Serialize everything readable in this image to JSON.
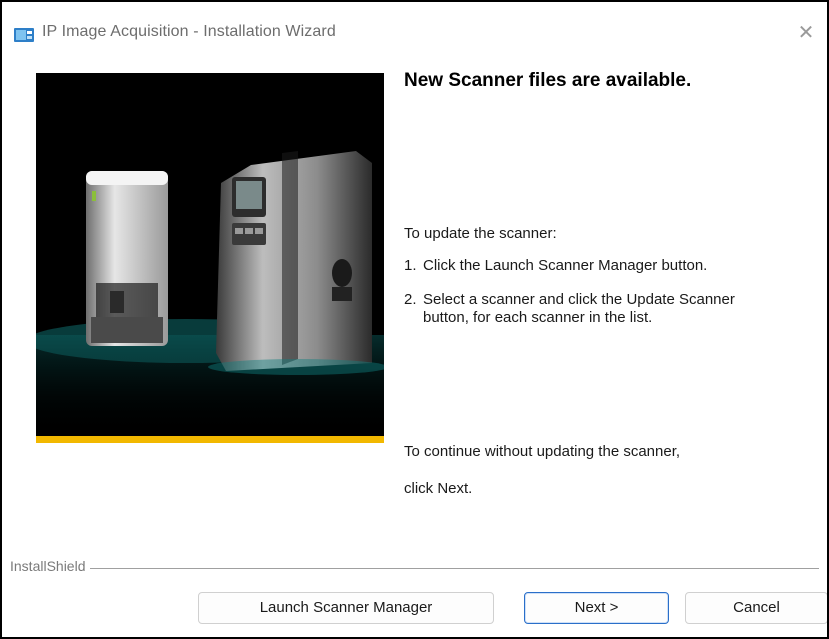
{
  "window": {
    "title": "IP Image Acquisition - Installation Wizard",
    "close_symbol": "✕"
  },
  "icons": {
    "app": "installer-app-icon",
    "close": "close-icon"
  },
  "content": {
    "heading": "New Scanner files are available.",
    "intro": "To update the scanner:",
    "steps": [
      {
        "num": "1.",
        "text": "Click the Launch Scanner Manager button."
      },
      {
        "num": "2.",
        "text": "Select a scanner and click the Update Scanner button, for each scanner in the list."
      }
    ],
    "continue_line1": "To continue without updating the scanner,",
    "continue_line2": "click Next."
  },
  "footer": {
    "brand": "InstallShield",
    "buttons": {
      "launch": "Launch Scanner Manager",
      "next": "Next >",
      "cancel": "Cancel"
    }
  },
  "colors": {
    "accent_stripe": "#f2b800",
    "primary_border": "#2a6fc9",
    "hero_background": "#000000"
  }
}
